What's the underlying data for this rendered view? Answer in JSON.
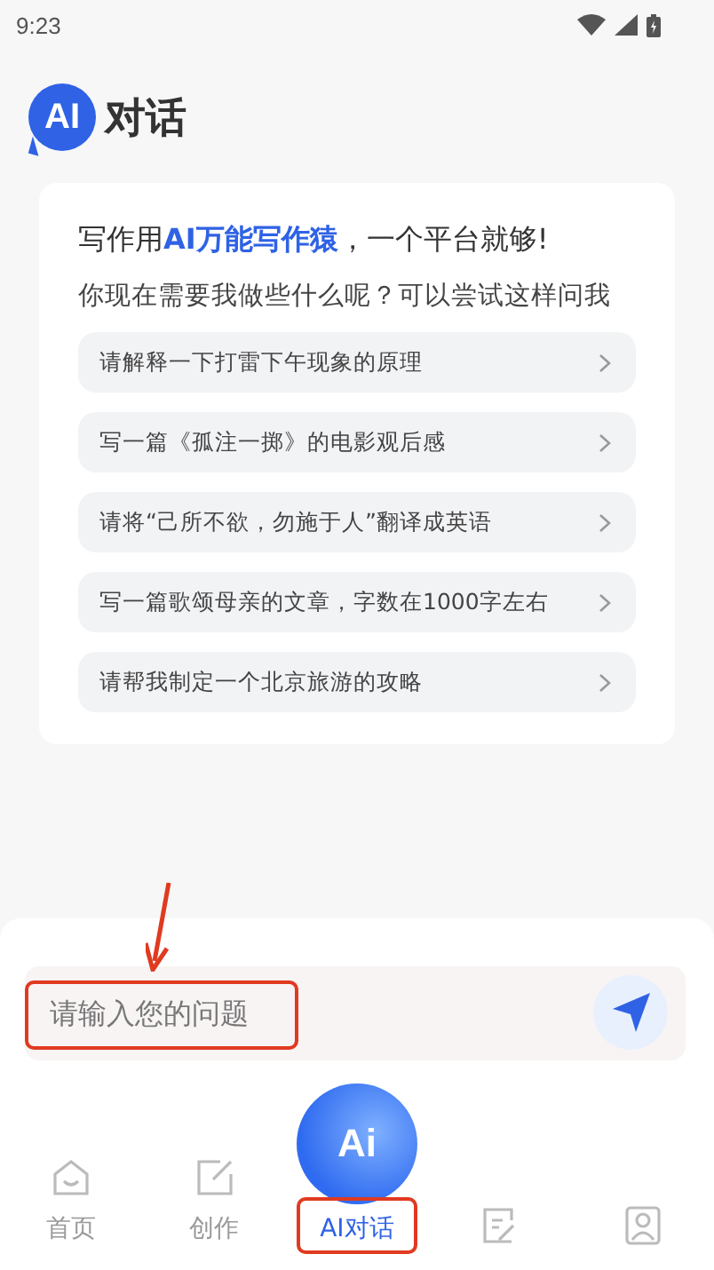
{
  "status_bar": {
    "time": "9:23"
  },
  "header": {
    "logo": "AI",
    "title": "对话"
  },
  "intro": {
    "headline": "写作用**AI万能写作猿**，一个平台就够!",
    "subtitle": "你现在需要我做些什么呢？可以尝试这样问我"
  },
  "suggestions": [
    {
      "text": "请解释一下打雷下午现象的原理"
    },
    {
      "text": "写一篇《孤注一掷》的电影观后感"
    },
    {
      "text": "请将“己所不欲，勿施于人”翻译成英语"
    },
    {
      "text": "写一篇歌颂母亲的文章，字数在1000字左右"
    },
    {
      "text": "请帮我制定一个北京旅游的攻略"
    }
  ],
  "input": {
    "placeholder": "请输入您的问题",
    "highlighted": true
  },
  "center_button": {
    "label": "Ai"
  },
  "nav": [
    {
      "kind": "home",
      "label": "首页",
      "selected": false,
      "highlighted": false
    },
    {
      "kind": "create",
      "label": "创作",
      "selected": false,
      "highlighted": false
    },
    {
      "kind": "ai",
      "label": "AI对话",
      "selected": true,
      "highlighted": true
    },
    {
      "kind": "doc",
      "selected": false,
      "highlighted": false
    },
    {
      "kind": "profile",
      "selected": false,
      "highlighted": false
    }
  ]
}
